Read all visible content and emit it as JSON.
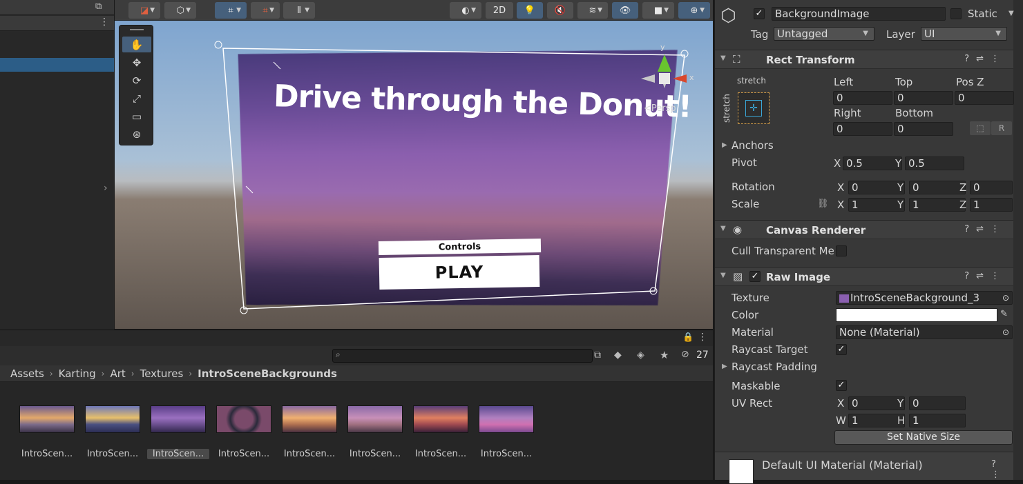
{
  "scene": {
    "title_text": "Drive through the Donut!",
    "controls_label": "Controls",
    "play_label": "PLAY",
    "persp_label": "<Persp",
    "gizmo_y": "y",
    "gizmo_x": "x",
    "toolbar_2d": "2D"
  },
  "project": {
    "hidden_count": "27",
    "breadcrumb": [
      "Assets",
      "Karting",
      "Art",
      "Textures",
      "IntroSceneBackgrounds"
    ],
    "assets": [
      {
        "label": "IntroScen..."
      },
      {
        "label": "IntroScen..."
      },
      {
        "label": "IntroScen..."
      },
      {
        "label": "IntroScen..."
      },
      {
        "label": "IntroScen..."
      },
      {
        "label": "IntroScen..."
      },
      {
        "label": "IntroScen..."
      },
      {
        "label": "IntroScen..."
      }
    ]
  },
  "inspector": {
    "object_name": "BackgroundImage",
    "static_label": "Static",
    "tag_label": "Tag",
    "tag_value": "Untagged",
    "layer_label": "Layer",
    "layer_value": "UI",
    "rect_transform": {
      "title": "Rect Transform",
      "anchor_preset_h": "stretch",
      "anchor_preset_v": "stretch",
      "left_label": "Left",
      "left": "0",
      "top_label": "Top",
      "top": "0",
      "posz_label": "Pos Z",
      "posz": "0",
      "right_label": "Right",
      "right": "0",
      "bottom_label": "Bottom",
      "bottom": "0",
      "anchors_label": "Anchors",
      "pivot_label": "Pivot",
      "pivot_x": "0.5",
      "pivot_y": "0.5",
      "rotation_label": "Rotation",
      "rot_x": "0",
      "rot_y": "0",
      "rot_z": "0",
      "scale_label": "Scale",
      "scale_x": "1",
      "scale_y": "1",
      "scale_z": "1",
      "x": "X",
      "y": "Y",
      "z": "Z"
    },
    "canvas_renderer": {
      "title": "Canvas Renderer",
      "cull_label": "Cull Transparent Mes"
    },
    "raw_image": {
      "title": "Raw Image",
      "texture_label": "Texture",
      "texture_value": "IntroSceneBackground_3",
      "color_label": "Color",
      "material_label": "Material",
      "material_value": "None (Material)",
      "raycast_target_label": "Raycast Target",
      "raycast_padding_label": "Raycast Padding",
      "maskable_label": "Maskable",
      "uvrect_label": "UV Rect",
      "uv_x": "0",
      "uv_y": "0",
      "uv_w": "1",
      "uv_h": "1",
      "w": "W",
      "h": "H",
      "native_size_button": "Set Native Size"
    },
    "material_footer": "Default UI Material (Material)"
  }
}
